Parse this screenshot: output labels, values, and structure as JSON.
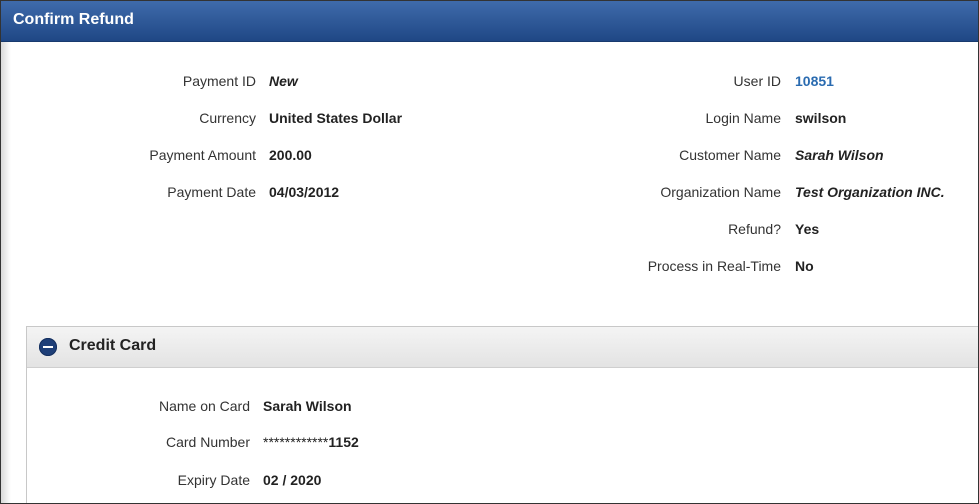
{
  "header": {
    "title": "Confirm Refund"
  },
  "payment": {
    "id_label": "Payment ID",
    "id_value": "New",
    "currency_label": "Currency",
    "currency_value": "United States Dollar",
    "amount_label": "Payment Amount",
    "amount_value": "200.00",
    "date_label": "Payment Date",
    "date_value": "04/03/2012"
  },
  "user": {
    "id_label": "User ID",
    "id_value": "10851",
    "login_label": "Login Name",
    "login_value": "swilson",
    "customer_label": "Customer Name",
    "customer_value": "Sarah Wilson",
    "org_label": "Organization Name",
    "org_value": "Test Organization INC.",
    "refund_label": "Refund?",
    "refund_value": "Yes",
    "realtime_label": "Process in Real-Time",
    "realtime_value": "No"
  },
  "credit_card": {
    "section_title": "Credit Card",
    "name_label": "Name on Card",
    "name_value": "Sarah Wilson",
    "number_label": "Card Number",
    "number_mask": "************",
    "number_last4": "1152",
    "expiry_label": "Expiry Date",
    "expiry_value": "02 / 2020"
  },
  "colors": {
    "header_bg": "#2b5797",
    "link": "#2a6bb0",
    "section_icon": "#1e3f78"
  },
  "icons": {
    "collapse": "minus-circle-icon"
  }
}
